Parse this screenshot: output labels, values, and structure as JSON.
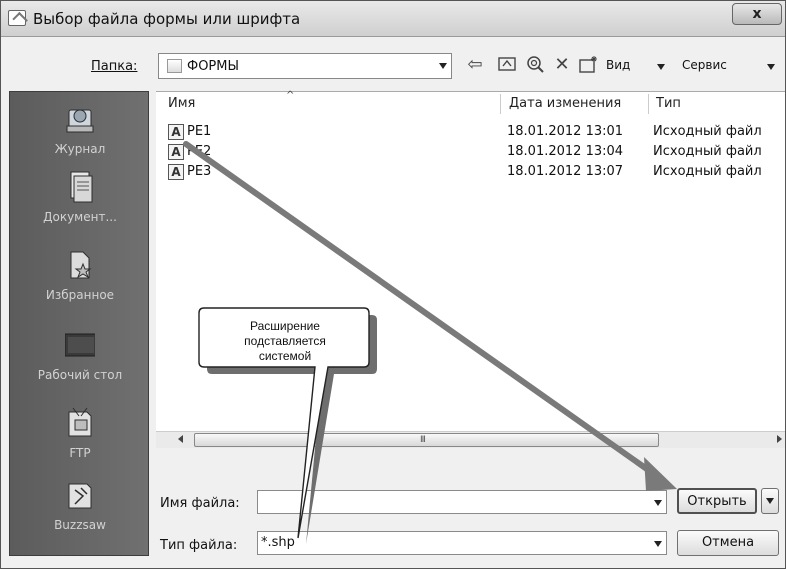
{
  "window": {
    "title": "Выбор файла формы или шрифта",
    "close_label": "x"
  },
  "toolbar": {
    "folder_label": "Папка:",
    "folder_value": "ФОРМЫ",
    "views_label": "Вид",
    "tools_label": "Сервис",
    "icons": [
      "back-icon",
      "up-folder-icon",
      "search-web-icon",
      "delete-icon",
      "new-folder-icon"
    ]
  },
  "places": [
    {
      "label": "Журнал",
      "icon": "history-icon"
    },
    {
      "label": "Документ...",
      "icon": "documents-icon"
    },
    {
      "label": "Избранное",
      "icon": "favorites-icon"
    },
    {
      "label": "Рабочий стол",
      "icon": "desktop-icon"
    },
    {
      "label": "FTP",
      "icon": "ftp-icon"
    },
    {
      "label": "Buzzsaw",
      "icon": "buzzsaw-icon"
    }
  ],
  "list": {
    "columns": {
      "name": "Имя",
      "date": "Дата изменения",
      "type": "Тип"
    },
    "rows": [
      {
        "name": "PE1",
        "date": "18.01.2012 13:01",
        "type": "Исходный файл"
      },
      {
        "name": "PE2",
        "date": "18.01.2012 13:04",
        "type": "Исходный файл"
      },
      {
        "name": "PE3",
        "date": "18.01.2012 13:07",
        "type": "Исходный файл"
      }
    ],
    "scroll_grip": "III"
  },
  "bottom": {
    "filename_label": "Имя файла:",
    "filename_value": "",
    "filetype_label": "Тип файла:",
    "filetype_value": "*.shp",
    "open_label": "Открыть",
    "cancel_label": "Отмена"
  },
  "callout": {
    "lines": [
      "Расширение",
      "подставляется",
      "системой"
    ]
  }
}
